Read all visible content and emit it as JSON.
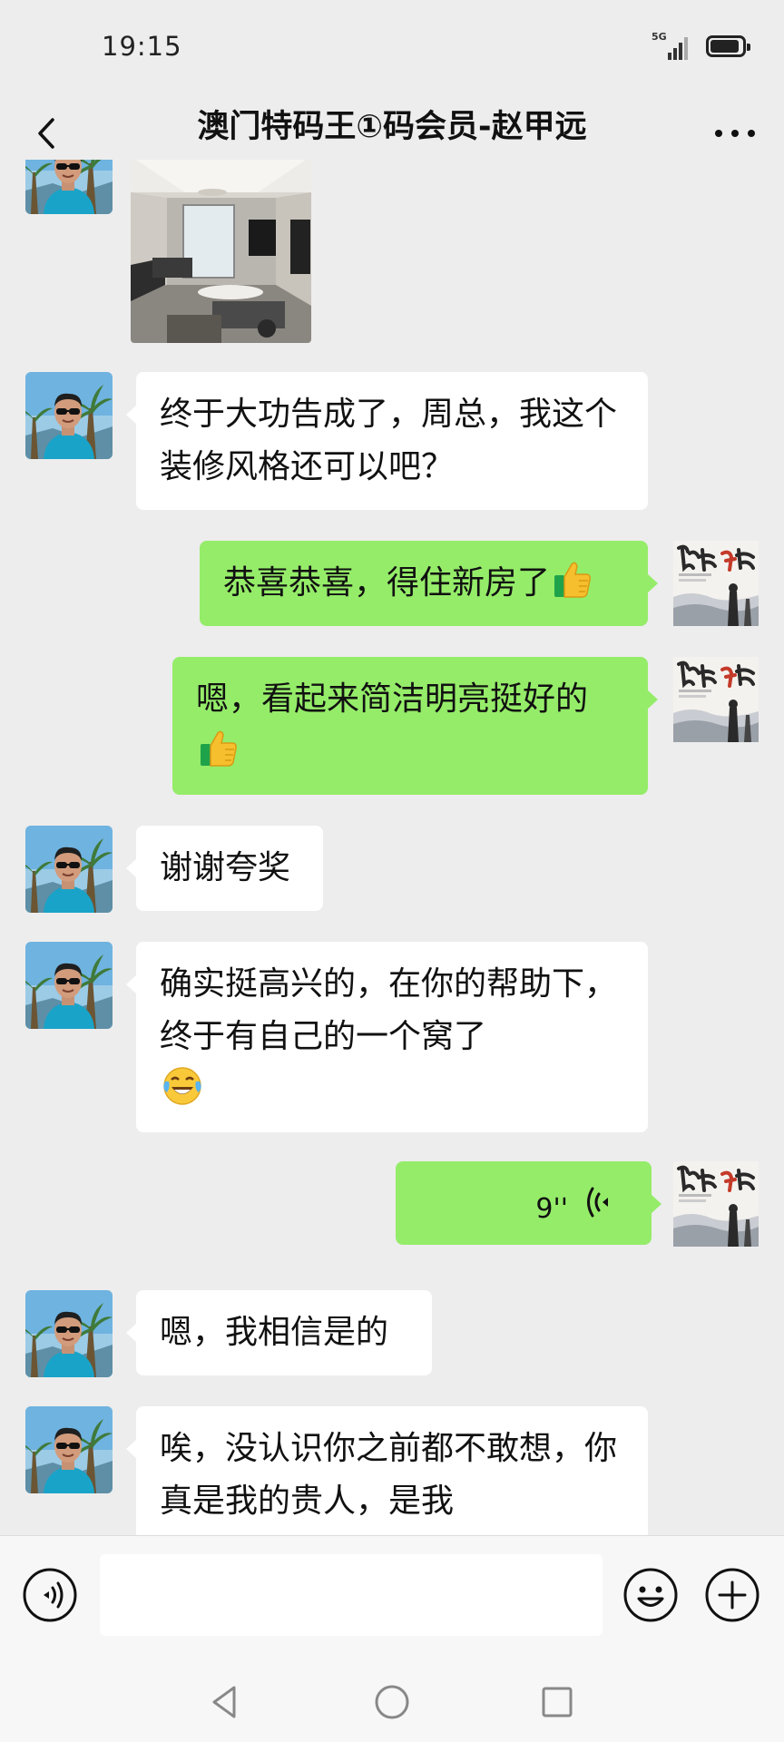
{
  "status_bar": {
    "time": "19:15",
    "network": "5G",
    "signal_level": 0.75,
    "battery_level": 0.9
  },
  "header": {
    "title": "澳门特码王①码会员-赵甲远",
    "back_icon": "chevron-left-icon",
    "more_icon": "more-dots-icon"
  },
  "messages": [
    {
      "sender": "contact",
      "type": "image",
      "content": "living-room-photo"
    },
    {
      "sender": "contact",
      "type": "text",
      "text": "终于大功告成了，周总，我这个装修风格还可以吧？"
    },
    {
      "sender": "me",
      "type": "text",
      "text": "恭喜恭喜，得住新房了",
      "emoji": "thumbs-up-emoji"
    },
    {
      "sender": "me",
      "type": "text",
      "text": "嗯，看起来简洁明亮挺好的",
      "emoji": "thumbs-up-emoji"
    },
    {
      "sender": "contact",
      "type": "text",
      "text": "谢谢夸奖"
    },
    {
      "sender": "contact",
      "type": "text",
      "text": "确实挺高兴的，在你的帮助下，终于有自己的一个窝了",
      "emoji": "laugh-cry-emoji"
    },
    {
      "sender": "me",
      "type": "voice",
      "duration": "9''"
    },
    {
      "sender": "contact",
      "type": "text",
      "text": "嗯，我相信是的"
    },
    {
      "sender": "contact",
      "type": "text",
      "text": "唉，没认识你之前都不敢想，你真是我的贵人，是我"
    }
  ],
  "input_bar": {
    "placeholder": "",
    "voice_icon": "voice-toggle-icon",
    "emoji_icon": "smiley-icon",
    "plus_icon": "plus-circle-icon"
  },
  "nav_bar": {
    "back_icon": "nav-back-triangle-icon",
    "home_icon": "nav-home-circle-icon",
    "recents_icon": "nav-recents-square-icon"
  },
  "colors": {
    "background": "#ededed",
    "outgoing_bubble": "#95ec69",
    "incoming_bubble": "#ffffff"
  }
}
